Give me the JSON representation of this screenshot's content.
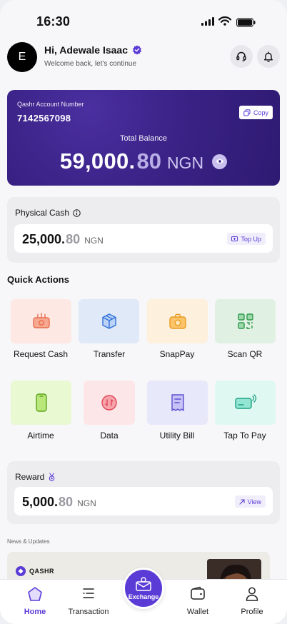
{
  "status_bar": {
    "time": "16:30"
  },
  "header": {
    "avatar_initial": "E",
    "greeting": "Hi, Adewale Isaac",
    "subtitle": "Welcome back, let's continue"
  },
  "account": {
    "label": "Qashr Account Number",
    "number": "7142567098",
    "copy_label": "Copy",
    "balance_label": "Total Balance",
    "balance_main": "59,000.",
    "balance_decimal": "80",
    "currency": "NGN"
  },
  "physical_cash": {
    "title": "Physical Cash",
    "amount_main": "25,000.",
    "amount_decimal": "80",
    "currency": "NGN",
    "action_label": "Top Up"
  },
  "quick_actions": {
    "title": "Quick Actions",
    "items": [
      {
        "label": "Request Cash",
        "icon": "request-cash-icon",
        "bg": "#fde8e4"
      },
      {
        "label": "Transfer",
        "icon": "transfer-icon",
        "bg": "#dfe9f8"
      },
      {
        "label": "SnapPay",
        "icon": "snappay-icon",
        "bg": "#fdf0dc"
      },
      {
        "label": "Scan QR",
        "icon": "scan-qr-icon",
        "bg": "#e0f1e4"
      },
      {
        "label": "Airtime",
        "icon": "airtime-icon",
        "bg": "#e9f9d2"
      },
      {
        "label": "Data",
        "icon": "data-icon",
        "bg": "#fde6e8"
      },
      {
        "label": "Utility Bill",
        "icon": "utility-bill-icon",
        "bg": "#e8e8fb"
      },
      {
        "label": "Tap To Pay",
        "icon": "tap-to-pay-icon",
        "bg": "#dff8f2"
      }
    ]
  },
  "reward": {
    "title": "Reward",
    "amount_main": "5,000.",
    "amount_decimal": "80",
    "currency": "NGN",
    "action_label": "View"
  },
  "news": {
    "title": "News & Updates",
    "brand": "QASHR"
  },
  "bottom_nav": {
    "items": [
      {
        "label": "Home",
        "icon": "home-icon"
      },
      {
        "label": "Transaction",
        "icon": "transaction-icon"
      },
      {
        "label": "Wallet",
        "icon": "wallet-icon"
      },
      {
        "label": "Profile",
        "icon": "profile-icon"
      }
    ],
    "center_label": "Exchange"
  },
  "colors": {
    "accent": "#5b3bd6",
    "card": "#3a2286"
  }
}
